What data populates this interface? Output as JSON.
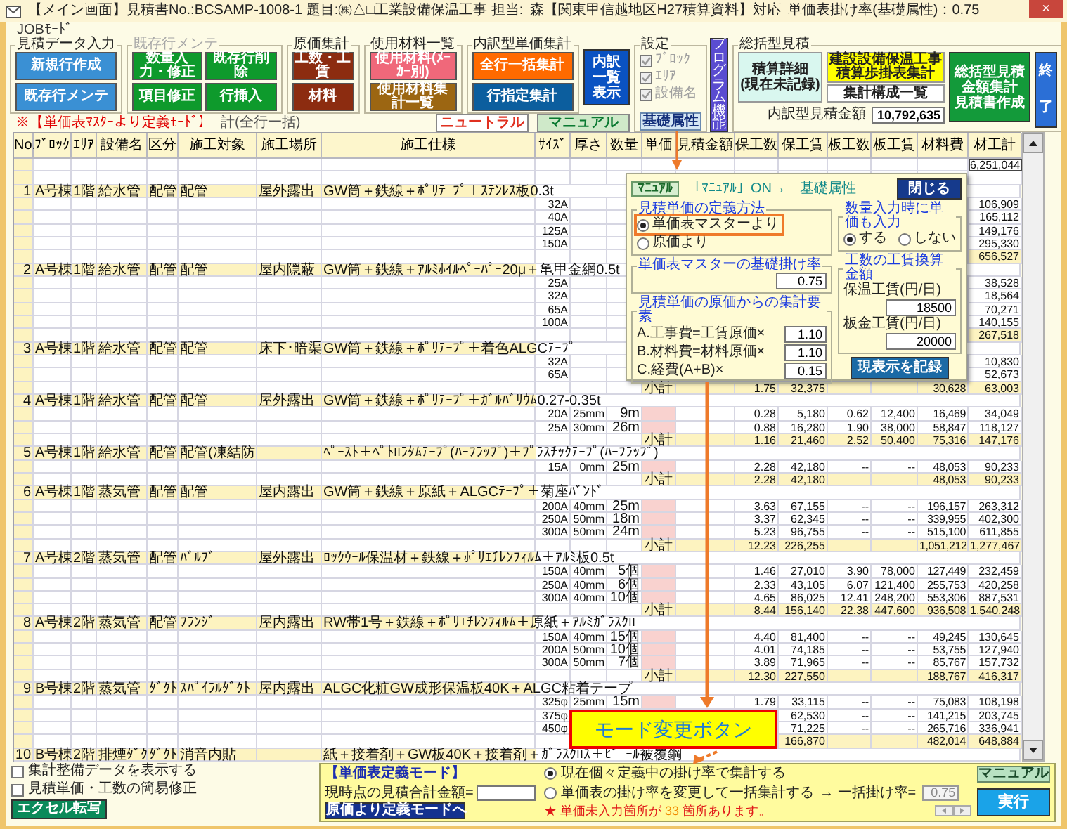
{
  "window": {
    "title": "【メイン画面】見積書No.:BCSAMP-1008-1 題目:㈱△□工業設備保温工事 担当:",
    "reference": "森【関東甲信越地区H27積算資料】対応",
    "rate": "単価表掛け率(基礎属性)：0.75",
    "close": "×"
  },
  "job_mode": "JOBﾓｰﾄﾞ",
  "groups": [
    {
      "title": "見積データ入力",
      "disabled": false,
      "buttons": [
        [
          {
            "label": "新規行作成",
            "color": "#3a90d4"
          }
        ],
        [
          {
            "label": "既存行メンテ",
            "color": "#3a90d4"
          }
        ]
      ]
    },
    {
      "title": "既存行メンテ",
      "disabled": true,
      "buttons": [
        [
          {
            "label": "数量入力・修正",
            "color": "#0e9a2c"
          },
          {
            "label": "既存行削除",
            "color": "#0e9a2c"
          }
        ],
        [
          {
            "label": "項目修正",
            "color": "#0e9a2c"
          },
          {
            "label": "行挿入",
            "color": "#0e9a2c"
          }
        ]
      ]
    },
    {
      "title": "原価集計",
      "disabled": false,
      "buttons": [
        [
          {
            "label": "工数・工賃",
            "color": "#8c2c10"
          }
        ],
        [
          {
            "label": "材料",
            "color": "#8c2c10"
          }
        ]
      ]
    },
    {
      "title": "使用材料一覧",
      "disabled": false,
      "buttons": [
        [
          {
            "label": "使用材料(ﾒｰｶｰ別)",
            "color": "#f0687a"
          }
        ],
        [
          {
            "label": "使用材料集計一覧",
            "color": "#9c6612"
          }
        ]
      ]
    },
    {
      "title": "内訳型単価集計",
      "disabled": false,
      "buttons": [
        [
          {
            "label": "全行一括集計",
            "color": "#ff6a00"
          }
        ],
        [
          {
            "label": "行指定集計",
            "color": "#0c5e9e"
          }
        ]
      ]
    }
  ],
  "list_button": "内訳一覧表示",
  "mode_notice": "※【単価表ﾏｽﾀｰより定義ﾓｰﾄﾞ】",
  "total_caption": "計(全行一括)",
  "mode_buttons": [
    {
      "label": "ニュートラル",
      "selected": false
    },
    {
      "label": "マニュアル",
      "selected": true
    }
  ],
  "settings": {
    "title": "設定",
    "checkboxes": [
      {
        "label": "ﾌﾞﾛｯｸ",
        "checked": true,
        "disabled": true
      },
      {
        "label": "ｴﾘｱ",
        "checked": true,
        "disabled": true
      },
      {
        "label": "設備名",
        "checked": true,
        "disabled": true
      }
    ],
    "base_button": "基礎属性",
    "program_button": "プログラム機能"
  },
  "summary": {
    "title": "総括型見積",
    "detail_button": [
      "積算詳細",
      "(現在未記録)"
    ],
    "tally_button": [
      "建設設備保温工事",
      "積算歩掛表集計"
    ],
    "list_button": "集計構成一覧",
    "estimate_button": [
      "総括型見積金額集計",
      "見積書作成"
    ],
    "exit_button": "終了",
    "amount_label": "内訳型見積金額",
    "amount": "10,792,635"
  },
  "table": {
    "columns": [
      "No.",
      "ﾌﾞﾛｯｸ",
      "ｴﾘｱ",
      "設備名",
      "区分",
      "施工対象",
      "施工場所",
      "施工仕様",
      "ｻｲｽﾞ",
      "厚さ",
      "数量",
      "単価",
      "見積金額",
      "保工数",
      "保工賃",
      "板工数",
      "板工賃",
      "材料費",
      "材工計"
    ],
    "rows": [
      {
        "kind": "total",
        "total": "6,251,044"
      },
      {
        "kind": "blank"
      },
      {
        "kind": "item",
        "no": "1",
        "block": "A号棟",
        "area": "1階",
        "equipment": "給水管",
        "category": "配管",
        "target": "配管",
        "place": "屋外露出",
        "spec": "GW筒＋鉄線＋ﾎﾟﾘﾃｰﾌﾟ＋ｽﾃﾝﾚｽ板0.3t"
      },
      {
        "kind": "detail",
        "size": "32A",
        "total": "106,909"
      },
      {
        "kind": "detail",
        "size": "40A",
        "total": "165,112"
      },
      {
        "kind": "detail",
        "size": "125A",
        "total": "149,176"
      },
      {
        "kind": "detail",
        "size": "150A",
        "total": "295,330"
      },
      {
        "kind": "subtotal",
        "total": "656,527"
      },
      {
        "kind": "item",
        "no": "2",
        "block": "A号棟",
        "area": "1階",
        "equipment": "給水管",
        "category": "配管",
        "target": "配管",
        "place": "屋内隠蔽",
        "spec": "GW筒＋鉄線＋ｱﾙﾐﾎｲﾙﾍﾟｰﾊﾟｰ20μ＋亀甲金網0.5t"
      },
      {
        "kind": "detail",
        "size": "25A",
        "total": "38,528"
      },
      {
        "kind": "detail",
        "size": "32A",
        "total": "18,564"
      },
      {
        "kind": "detail",
        "size": "65A",
        "total": "70,271"
      },
      {
        "kind": "detail",
        "size": "100A",
        "total": "140,155"
      },
      {
        "kind": "subtotal",
        "total": "267,518"
      },
      {
        "kind": "item",
        "no": "3",
        "block": "A号棟",
        "area": "1階",
        "equipment": "給水管",
        "category": "配管",
        "target": "配管",
        "place": "床下･暗渠",
        "spec": "GW筒＋鉄線＋ﾎﾟﾘﾃｰﾌﾟ＋着色ALGCﾃｰﾌﾟ"
      },
      {
        "kind": "detail",
        "size": "32A",
        "total": "10,830"
      },
      {
        "kind": "detail",
        "size": "65A",
        "total": "52,673"
      },
      {
        "kind": "subtotal",
        "label": "小計",
        "labor_hours": "1.75",
        "labor_cost": "32,375",
        "material": "30,628",
        "total": "63,003"
      },
      {
        "kind": "item",
        "no": "4",
        "block": "A号棟",
        "area": "1階",
        "equipment": "給水管",
        "category": "配管",
        "target": "配管",
        "place": "屋外露出",
        "spec": "GW筒＋鉄線＋ﾎﾟﾘﾃｰﾌﾟ＋ｶﾞﾙﾊﾞﾘｳﾑ0.27-0.35t"
      },
      {
        "kind": "detail",
        "size": "20A",
        "thickness": "25mm",
        "qty": "9m",
        "price_missing": true,
        "labor_hours": "0.28",
        "labor_cost": "5,180",
        "sheet_hours": "0.62",
        "sheet_cost": "12,400",
        "material": "16,469",
        "total": "34,049"
      },
      {
        "kind": "detail",
        "size": "25A",
        "thickness": "30mm",
        "qty": "26m",
        "price_missing": true,
        "labor_hours": "0.88",
        "labor_cost": "16,280",
        "sheet_hours": "1.90",
        "sheet_cost": "38,000",
        "material": "58,847",
        "total": "118,127"
      },
      {
        "kind": "subtotal",
        "label": "小計",
        "labor_hours": "1.16",
        "labor_cost": "21,460",
        "sheet_hours": "2.52",
        "sheet_cost": "50,400",
        "material": "75,316",
        "total": "147,176"
      },
      {
        "kind": "item",
        "no": "5",
        "block": "A号棟",
        "area": "1階",
        "equipment": "給水管",
        "category": "配管",
        "target": "配管(凍結防",
        "spec": "ﾍﾟｰｽﾄ＋ﾍﾟﾄﾛﾗﾀﾑﾃｰﾌﾟ(ﾊｰﾌﾗｯﾌﾟ)＋ﾌﾟﾗｽﾁｯｸﾃｰﾌﾟ(ﾊｰﾌﾗｯﾌﾟ)"
      },
      {
        "kind": "detail",
        "size": "15A",
        "thickness": "0mm",
        "qty": "25m",
        "price_missing": true,
        "labor_hours": "2.28",
        "labor_cost": "42,180",
        "sheet_hours": "--",
        "sheet_cost": "--",
        "material": "48,053",
        "total": "90,233"
      },
      {
        "kind": "subtotal",
        "label": "小計",
        "labor_hours": "2.28",
        "labor_cost": "42,180",
        "material": "48,053",
        "total": "90,233"
      },
      {
        "kind": "item",
        "no": "6",
        "block": "A号棟",
        "area": "1階",
        "equipment": "蒸気管",
        "category": "配管",
        "target": "配管",
        "place": "屋内露出",
        "spec": "GW筒＋鉄線＋原紙＋ALGCﾃｰﾌﾟ＋菊座ﾊﾞﾝﾄﾞ"
      },
      {
        "kind": "detail",
        "size": "200A",
        "thickness": "40mm",
        "qty": "25m",
        "price_missing": true,
        "labor_hours": "3.63",
        "labor_cost": "67,155",
        "sheet_hours": "--",
        "sheet_cost": "--",
        "material": "196,157",
        "total": "263,312"
      },
      {
        "kind": "detail",
        "size": "250A",
        "thickness": "50mm",
        "qty": "18m",
        "price_missing": true,
        "labor_hours": "3.37",
        "labor_cost": "62,345",
        "sheet_hours": "--",
        "sheet_cost": "--",
        "material": "339,955",
        "total": "402,300"
      },
      {
        "kind": "detail",
        "size": "300A",
        "thickness": "50mm",
        "qty": "24m",
        "price_missing": true,
        "labor_hours": "5.23",
        "labor_cost": "96,755",
        "sheet_hours": "--",
        "sheet_cost": "--",
        "material": "515,100",
        "total": "611,855"
      },
      {
        "kind": "subtotal",
        "label": "小計",
        "labor_hours": "12.23",
        "labor_cost": "226,255",
        "material": "1,051,212",
        "total": "1,277,467"
      },
      {
        "kind": "item",
        "no": "7",
        "block": "A号棟",
        "area": "2階",
        "equipment": "蒸気管",
        "category": "配管",
        "target": "ﾊﾞﾙﾌﾞ",
        "place": "屋外露出",
        "spec": "ﾛｯｸｳｰﾙ保温材＋鉄線＋ﾎﾟﾘｴﾁﾚﾝﾌｨﾙﾑ＋ｱﾙﾐ板0.5t"
      },
      {
        "kind": "detail",
        "size": "150A",
        "thickness": "40mm",
        "qty": "5個",
        "price_missing": true,
        "labor_hours": "1.46",
        "labor_cost": "27,010",
        "sheet_hours": "3.90",
        "sheet_cost": "78,000",
        "material": "127,449",
        "total": "232,459"
      },
      {
        "kind": "detail",
        "size": "250A",
        "thickness": "40mm",
        "qty": "6個",
        "price_missing": true,
        "labor_hours": "2.33",
        "labor_cost": "43,105",
        "sheet_hours": "6.07",
        "sheet_cost": "121,400",
        "material": "255,753",
        "total": "420,258"
      },
      {
        "kind": "detail",
        "size": "300A",
        "thickness": "40mm",
        "qty": "10個",
        "price_missing": true,
        "labor_hours": "4.65",
        "labor_cost": "86,025",
        "sheet_hours": "12.41",
        "sheet_cost": "248,200",
        "material": "553,306",
        "total": "887,531"
      },
      {
        "kind": "subtotal",
        "label": "小計",
        "labor_hours": "8.44",
        "labor_cost": "156,140",
        "sheet_hours": "22.38",
        "sheet_cost": "447,600",
        "material": "936,508",
        "total": "1,540,248"
      },
      {
        "kind": "item",
        "no": "8",
        "block": "A号棟",
        "area": "2階",
        "equipment": "蒸気管",
        "category": "配管",
        "target": "ﾌﾗﾝｼﾞ",
        "place": "屋内露出",
        "spec": "RW帯1号＋鉄線＋ﾎﾟﾘｴﾁﾚﾝﾌｨﾙﾑ＋原紙＋ｱﾙﾐｶﾞﾗｽｸﾛ"
      },
      {
        "kind": "detail",
        "size": "150A",
        "thickness": "40mm",
        "qty": "15個",
        "price_missing": true,
        "labor_hours": "4.40",
        "labor_cost": "81,400",
        "sheet_hours": "--",
        "sheet_cost": "--",
        "material": "49,245",
        "total": "130,645"
      },
      {
        "kind": "detail",
        "size": "200A",
        "thickness": "50mm",
        "qty": "10個",
        "price_missing": true,
        "labor_hours": "4.01",
        "labor_cost": "74,185",
        "sheet_hours": "--",
        "sheet_cost": "--",
        "material": "53,755",
        "total": "127,940"
      },
      {
        "kind": "detail",
        "size": "300A",
        "thickness": "50mm",
        "qty": "7個",
        "price_missing": true,
        "labor_hours": "3.89",
        "labor_cost": "71,965",
        "sheet_hours": "--",
        "sheet_cost": "--",
        "material": "85,767",
        "total": "157,732"
      },
      {
        "kind": "subtotal",
        "label": "小計",
        "labor_hours": "12.30",
        "labor_cost": "227,550",
        "material": "188,767",
        "total": "416,317"
      },
      {
        "kind": "item",
        "no": "9",
        "block": "B号棟",
        "area": "2階",
        "equipment": "蒸気管",
        "category": "ﾀﾞｸﾄ",
        "target": "ｽﾊﾟｲﾗﾙﾀﾞｸﾄ",
        "place": "屋内露出",
        "spec": "ALGC化粧GW成形保温板40K＋ALGC粘着テープ"
      },
      {
        "kind": "detail",
        "size": "325φ",
        "thickness": "25mm",
        "qty": "15m",
        "price_missing": true,
        "labor_hours": "1.79",
        "labor_cost": "33,115",
        "sheet_hours": "--",
        "sheet_cost": "--",
        "material": "75,083",
        "total": "108,198"
      },
      {
        "kind": "detail",
        "size": "375φ",
        "labor_cost": "62,530",
        "sheet_hours": "--",
        "sheet_cost": "--",
        "material": "141,215",
        "total": "203,745"
      },
      {
        "kind": "detail",
        "size": "450φ",
        "labor_cost": "71,225",
        "sheet_hours": "--",
        "sheet_cost": "--",
        "material": "265,716",
        "total": "336,941"
      },
      {
        "kind": "subtotal",
        "labor_cost": "166,870",
        "material": "482,014",
        "total": "648,884"
      },
      {
        "kind": "item",
        "no": "10",
        "block": "B号棟",
        "area": "2階",
        "equipment": "排煙ﾀﾞｸ",
        "category": "ﾀﾞｸﾄ",
        "target": "消音内貼",
        "spec": "紙＋接着剤＋GW板40K＋接着剤＋ｶﾞﾗｽｸﾛｽ＋ﾋﾞﾆｰﾙ被覆鋼"
      }
    ]
  },
  "popup": {
    "tab": "ﾏﾆｭｱﾙ",
    "note": "「ﾏﾆｭｱﾙ」ON→　基礎属性",
    "close": "閉じる",
    "definition": {
      "title": "見積単価の定義方法",
      "options": [
        {
          "label": "単価表マスターより",
          "selected": true,
          "highlighted": true
        },
        {
          "label": "原価より",
          "selected": false,
          "highlighted": false
        }
      ]
    },
    "base_rate": {
      "title": "単価表マスターの基礎掛け率",
      "value": "0.75"
    },
    "factors": {
      "title": "見積単価の原価からの集計要素",
      "items": [
        {
          "label": "A.工事費=工賃原価×",
          "value": "1.10"
        },
        {
          "label": "B.材料費=材料原価×",
          "value": "1.10"
        },
        {
          "label": "C.経費(A+B)×",
          "value": "0.15"
        }
      ]
    },
    "price_input": {
      "title": "数量入力時に単価も入力",
      "options": [
        {
          "label": "する",
          "selected": true
        },
        {
          "label": "しない",
          "selected": false
        }
      ]
    },
    "wages": {
      "title": "工数の工賃換算金額",
      "items": [
        {
          "label": "保温工賃(円/日)",
          "value": "18500"
        },
        {
          "label": "板金工賃(円/日)",
          "value": "20000"
        }
      ]
    },
    "save": "現表示を記録"
  },
  "callout": "モード変更ボタン",
  "bottom": {
    "checkboxes": [
      {
        "label": "集計整備データを表示する",
        "checked": false
      },
      {
        "label": "見積単価・工数の簡易修正",
        "checked": false
      }
    ],
    "excel_button": "エクセル転写"
  },
  "mode_panel": {
    "title": "【単価表定義モード】",
    "total_label": "現時点の見積合計金額=",
    "switch_button": "原価より定義モードへ",
    "options": [
      {
        "label": "現在個々定義中の掛け率で集計する",
        "selected": true
      },
      {
        "label": "単価表の掛け率を変更して一括集計する",
        "selected": false
      }
    ],
    "rate_label": "→ 一括掛け率=",
    "rate_value": "0.75",
    "warning": "★ 単価未入力箇所が",
    "warning_count": "33",
    "warning_tail": "箇所あります。",
    "manual_button": "マニュアル",
    "run_button": "実行"
  }
}
